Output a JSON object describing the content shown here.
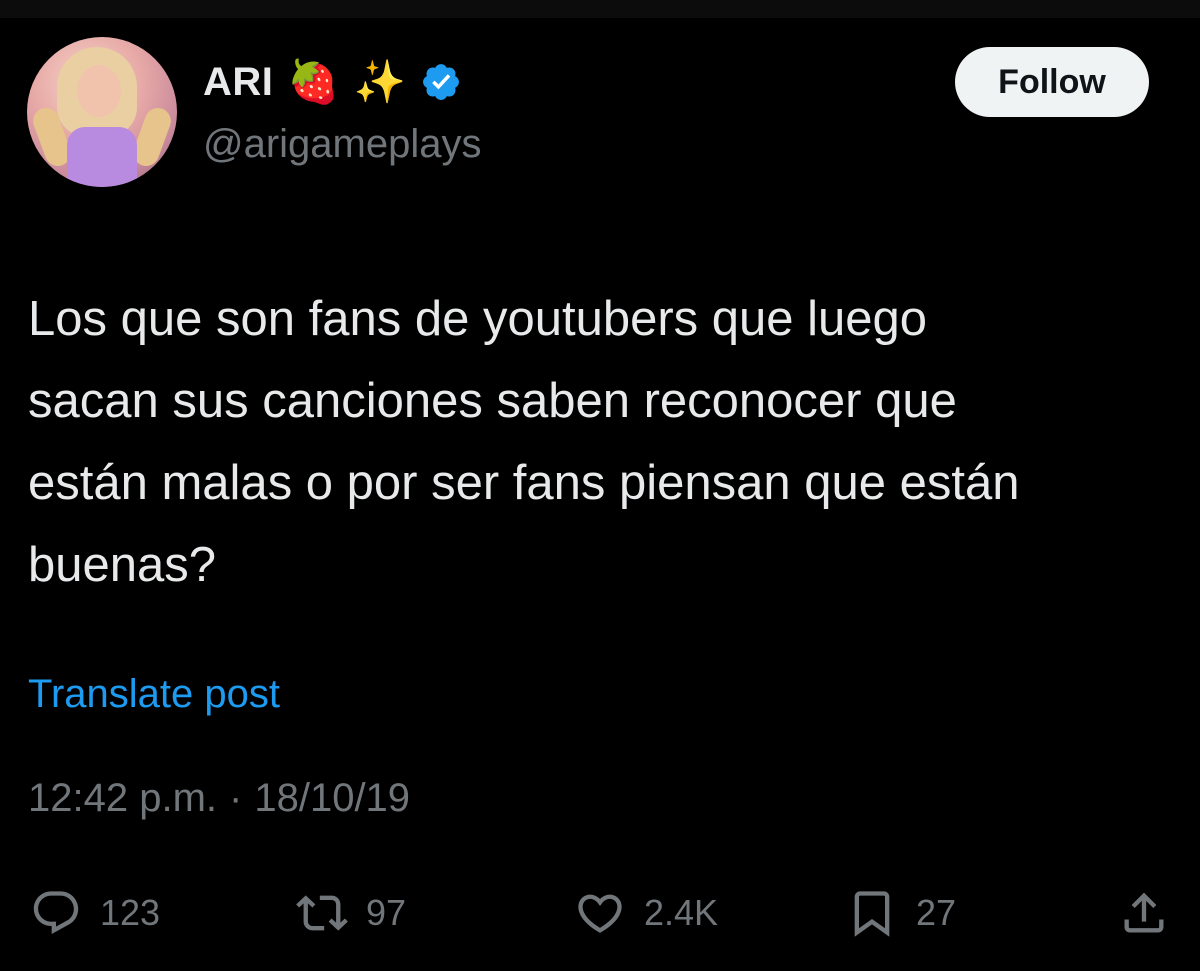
{
  "author": {
    "display_name": "ARI",
    "emojis": [
      "🍓",
      "✨"
    ],
    "handle": "@arigameplays",
    "verified": true
  },
  "follow_label": "Follow",
  "post": {
    "text": "Los que son fans de youtubers que luego\nsacan sus canciones saben reconocer que\nestán malas o por ser fans piensan que están\nbuenas?",
    "translate_label": "Translate post",
    "time": "12:42 p.m.",
    "separator": "·",
    "date": "18/10/19"
  },
  "actions": {
    "replies": "123",
    "reposts": "97",
    "likes": "2.4K",
    "bookmarks": "27"
  },
  "colors": {
    "background": "#000000",
    "text": "#e7e9ea",
    "muted": "#71767b",
    "link": "#1d9bf0",
    "verified": "#1d9bf0"
  },
  "icons": {
    "reply": "reply-icon",
    "repost": "repost-icon",
    "like": "heart-icon",
    "bookmark": "bookmark-icon",
    "share": "share-icon"
  }
}
